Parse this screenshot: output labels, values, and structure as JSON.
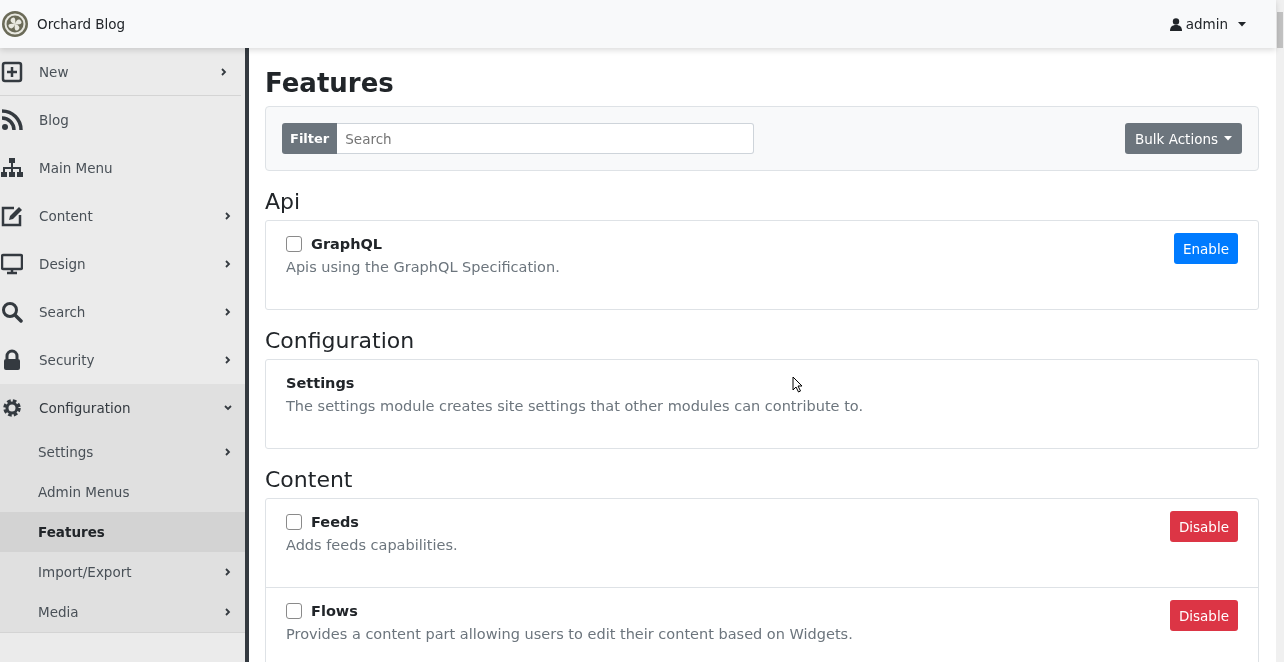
{
  "brand": {
    "title": "Orchard Blog"
  },
  "user_menu": {
    "label": "admin"
  },
  "sidebar": {
    "items": [
      {
        "label": "New",
        "chevron": true,
        "expanded": false,
        "selected": false
      },
      {
        "label": "Blog",
        "chevron": false,
        "expanded": false,
        "selected": false
      },
      {
        "label": "Main Menu",
        "chevron": false,
        "expanded": false,
        "selected": false
      },
      {
        "label": "Content",
        "chevron": true,
        "expanded": false,
        "selected": false
      },
      {
        "label": "Design",
        "chevron": true,
        "expanded": false,
        "selected": false
      },
      {
        "label": "Search",
        "chevron": true,
        "expanded": false,
        "selected": false
      },
      {
        "label": "Security",
        "chevron": true,
        "expanded": false,
        "selected": false
      },
      {
        "label": "Configuration",
        "chevron": true,
        "expanded": true,
        "selected": false,
        "children": [
          {
            "label": "Settings",
            "chevron": true,
            "selected": false
          },
          {
            "label": "Admin Menus",
            "chevron": false,
            "selected": false
          },
          {
            "label": "Features",
            "chevron": false,
            "selected": true
          },
          {
            "label": "Import/Export",
            "chevron": true,
            "selected": false
          },
          {
            "label": "Media",
            "chevron": true,
            "selected": false
          }
        ]
      }
    ]
  },
  "page": {
    "title": "Features",
    "filter": {
      "label": "Filter",
      "placeholder": "Search"
    },
    "bulk_actions": {
      "label": "Bulk Actions"
    },
    "sections": [
      {
        "title": "Api",
        "features": [
          {
            "name": "GraphQL",
            "description": "Apis using the GraphQL Specification.",
            "checked": false,
            "action": {
              "label": "Enable",
              "kind": "enable"
            }
          }
        ]
      },
      {
        "title": "Configuration",
        "features": [
          {
            "name": "Settings",
            "description": "The settings module creates site settings that other modules can contribute to."
          }
        ]
      },
      {
        "title": "Content",
        "features": [
          {
            "name": "Feeds",
            "description": "Adds feeds capabilities.",
            "checked": false,
            "action": {
              "label": "Disable",
              "kind": "disable"
            }
          },
          {
            "name": "Flows",
            "description": "Provides a content part allowing users to edit their content based on Widgets.",
            "checked": false,
            "action": {
              "label": "Disable",
              "kind": "disable"
            }
          }
        ]
      }
    ]
  }
}
